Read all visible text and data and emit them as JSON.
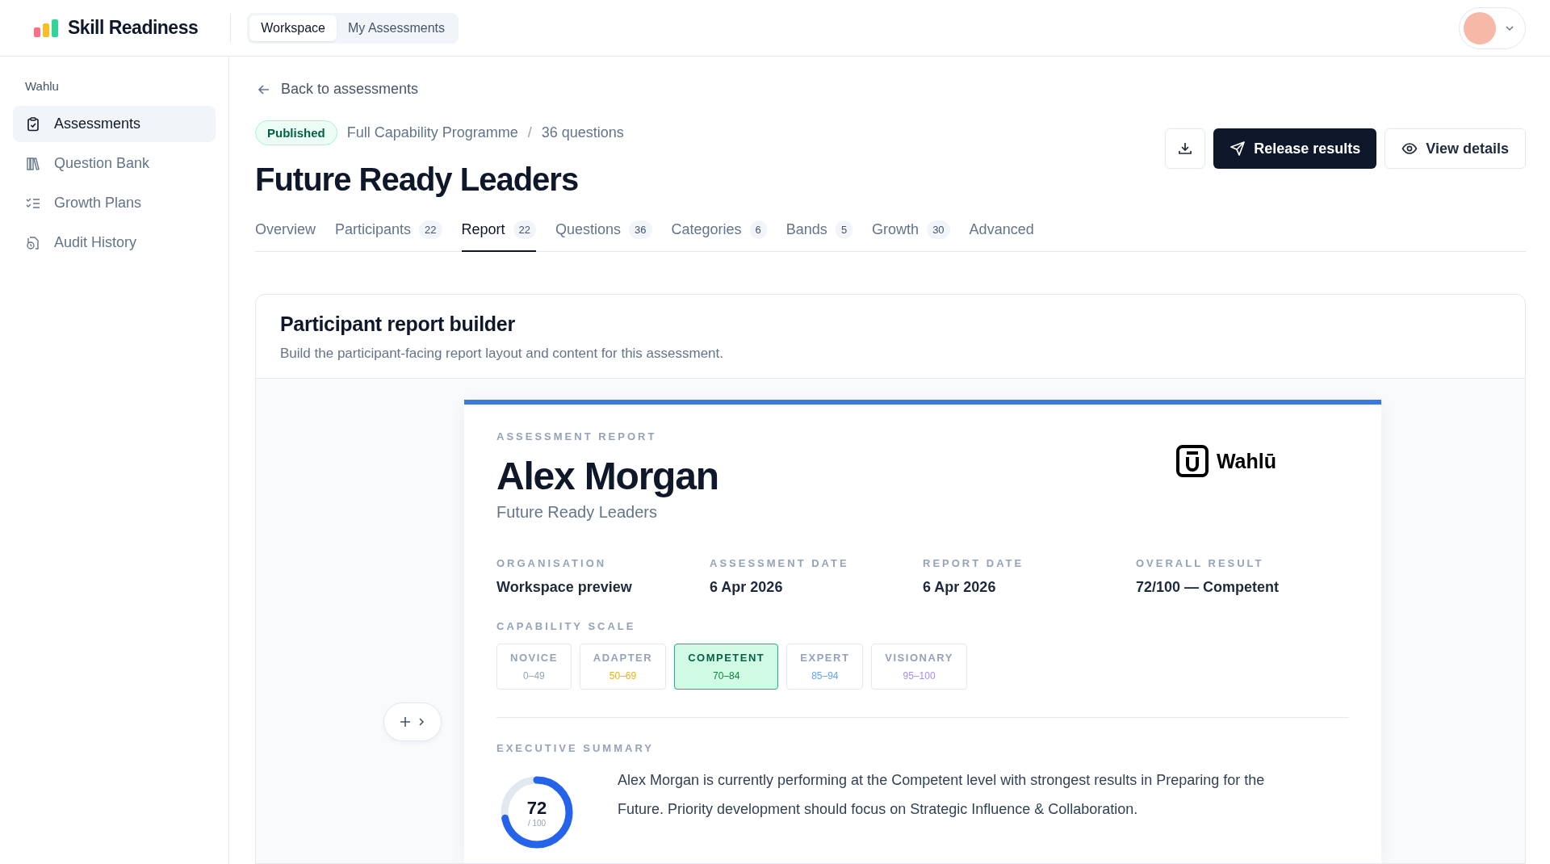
{
  "header": {
    "app_name": "Skill Readiness",
    "switcher": [
      {
        "label": "Workspace",
        "selected": true
      },
      {
        "label": "My Assessments",
        "selected": false
      }
    ]
  },
  "sidebar": {
    "workspace": "Wahlu",
    "items": [
      {
        "label": "Assessments",
        "selected": true
      },
      {
        "label": "Question Bank",
        "selected": false
      },
      {
        "label": "Growth Plans",
        "selected": false
      },
      {
        "label": "Audit History",
        "selected": false
      }
    ]
  },
  "back_link": "Back to assessments",
  "status": "Published",
  "programme": "Full Capability Programme",
  "separator": "/",
  "question_count": "36 questions",
  "title": "Future Ready Leaders",
  "actions": {
    "primary": "Release results",
    "secondary": "View details"
  },
  "tabs": [
    {
      "label": "Overview",
      "selected": false
    },
    {
      "label": "Participants",
      "count": "22",
      "selected": false
    },
    {
      "label": "Report",
      "count": "22",
      "selected": true
    },
    {
      "label": "Questions",
      "count": "36",
      "selected": false
    },
    {
      "label": "Categories",
      "count": "6",
      "selected": false
    },
    {
      "label": "Bands",
      "count": "5",
      "selected": false
    },
    {
      "label": "Growth",
      "count": "30",
      "selected": false
    },
    {
      "label": "Advanced",
      "selected": false
    }
  ],
  "builder": {
    "title": "Participant report builder",
    "subtitle": "Build the participant-facing report layout and content for this assessment.",
    "report": {
      "eyebrow": "ASSESSMENT REPORT",
      "name": "Alex Morgan",
      "assessment": "Future Ready Leaders",
      "logo_text": "Wahlū",
      "meta": [
        {
          "label": "ORGANISATION",
          "value": "Workspace preview"
        },
        {
          "label": "ASSESSMENT DATE",
          "value": "6 Apr 2026"
        },
        {
          "label": "REPORT DATE",
          "value": "6 Apr 2026"
        },
        {
          "label": "OVERALL RESULT",
          "value": "72/100 — Competent"
        }
      ],
      "scale_label": "CAPABILITY SCALE",
      "scale": [
        {
          "name": "NOVICE",
          "range": "0–49",
          "color": "#94a3b8",
          "selected": false
        },
        {
          "name": "ADAPTER",
          "range": "50–69",
          "color": "#eab308",
          "selected": false
        },
        {
          "name": "COMPETENT",
          "range": "70–84",
          "color": "#15803d",
          "selected": true
        },
        {
          "name": "EXPERT",
          "range": "85–94",
          "color": "#60a5fa",
          "selected": false
        },
        {
          "name": "VISIONARY",
          "range": "95–100",
          "color": "#a78bfa",
          "selected": false
        }
      ],
      "summary_label": "EXECUTIVE SUMMARY",
      "score": {
        "value": "72",
        "max": "/ 100",
        "level": 0.72
      },
      "summary": "Alex Morgan is currently performing at the Competent level with strongest results in Preparing for the Future. Priority development should focus on Strategic Influence & Collaboration."
    }
  }
}
